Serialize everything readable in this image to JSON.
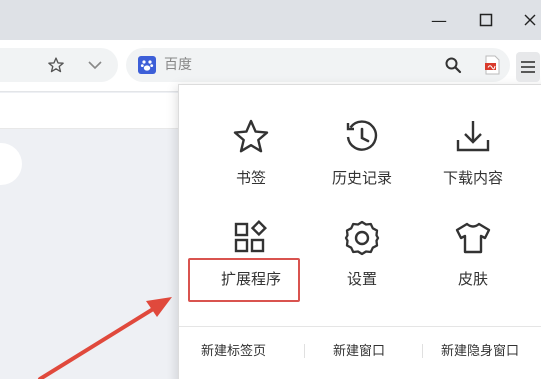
{
  "window": {
    "minimize_glyph": "—",
    "maximize_glyph": "☐",
    "close_glyph": "✕"
  },
  "toolbar": {
    "search_placeholder": "百度",
    "icons": [
      "star-icon",
      "chevron-down-icon",
      "baidu-paw-icon",
      "search-icon",
      "pdf-icon",
      "menu-icon"
    ]
  },
  "menu": {
    "tiles": [
      {
        "label": "书签",
        "icon": "star-icon"
      },
      {
        "label": "历史记录",
        "icon": "history-icon"
      },
      {
        "label": "下载内容",
        "icon": "download-icon"
      },
      {
        "label": "扩展程序",
        "icon": "extensions-icon"
      },
      {
        "label": "设置",
        "icon": "settings-icon"
      },
      {
        "label": "皮肤",
        "icon": "skin-icon"
      }
    ],
    "bottom_links": [
      "新建标签页",
      "新建窗口",
      "新建隐身窗口"
    ]
  },
  "colors": {
    "highlight": "#d9534f",
    "arrow": "#e0493c",
    "engine_badge": "#3d5fd8",
    "pdf_red": "#d93a2b"
  }
}
